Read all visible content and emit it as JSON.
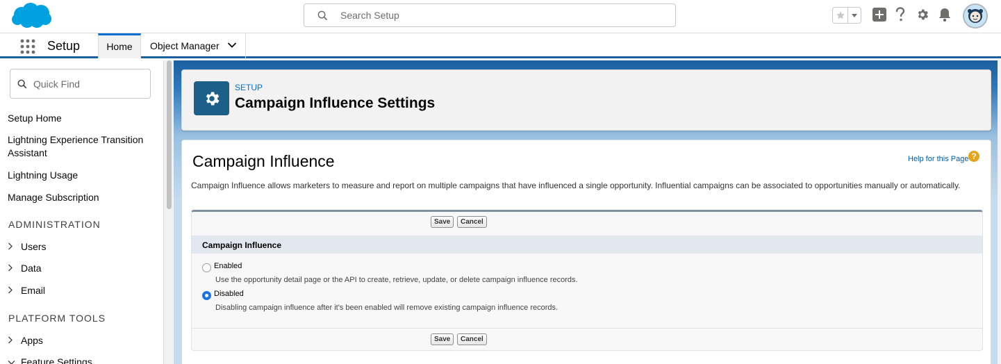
{
  "header": {
    "search_placeholder": "Search Setup",
    "icons": [
      "salesforce-logo",
      "search-icon",
      "star-icon",
      "caret-down-icon",
      "plus-icon",
      "help-icon",
      "gear-icon",
      "bell-icon",
      "avatar"
    ]
  },
  "context_bar": {
    "app_name": "Setup",
    "tabs": [
      {
        "label": "Home"
      },
      {
        "label": "Object Manager"
      }
    ]
  },
  "sidebar": {
    "quick_find_placeholder": "Quick Find",
    "links": [
      {
        "label": "Setup Home"
      },
      {
        "label": "Lightning Experience Transition Assistant"
      },
      {
        "label": "Lightning Usage"
      },
      {
        "label": "Manage Subscription"
      }
    ],
    "sections": [
      {
        "heading": "ADMINISTRATION",
        "items": [
          "Users",
          "Data",
          "Email"
        ]
      },
      {
        "heading": "PLATFORM TOOLS",
        "items": [
          "Apps",
          "Feature Settings"
        ]
      }
    ]
  },
  "page_header": {
    "eyebrow": "SETUP",
    "title": "Campaign Influence Settings"
  },
  "content": {
    "section_title": "Campaign Influence",
    "help_link": "Help for this Page",
    "description": "Campaign Influence allows marketers to measure and report on multiple campaigns that have influenced a single opportunity. Influential campaigns can be associated to opportunities manually or automatically.",
    "save_label": "Save",
    "cancel_label": "Cancel",
    "block_header": "Campaign Influence",
    "options": [
      {
        "label": "Enabled",
        "help": "Use the opportunity detail page or the API to create, retrieve, update, or delete campaign influence records.",
        "checked": false
      },
      {
        "label": "Disabled",
        "help": "Disabling campaign influence after it's been enabled will remove existing campaign influence records.",
        "checked": true
      }
    ]
  },
  "colors": {
    "brand_blue": "#0070d2",
    "header_icon_bg": "#1c5f88",
    "help_orange": "#e5a21b"
  }
}
